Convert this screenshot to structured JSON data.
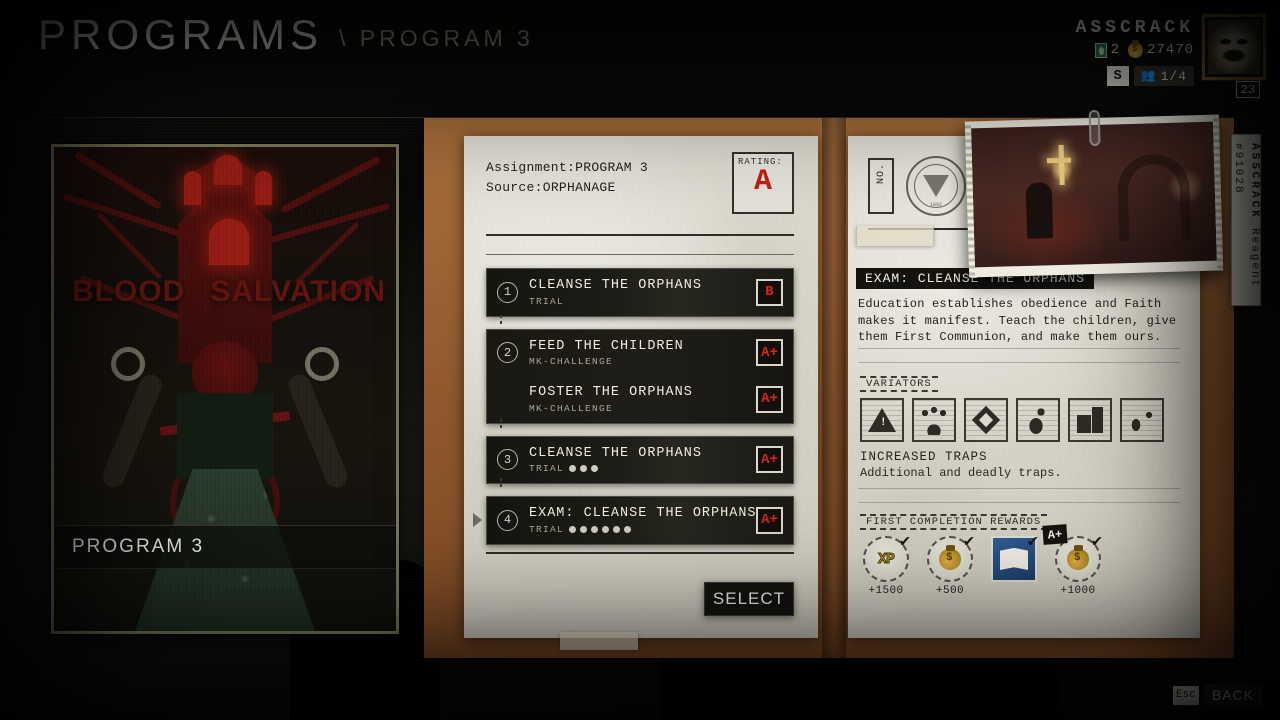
{
  "header": {
    "title": "PROGRAMS",
    "breadcrumb": "\\ PROGRAM 3"
  },
  "hud": {
    "player_name": "ASSCRACK",
    "bust_count": "2",
    "money": "27470",
    "rank": "S",
    "party": "1/4",
    "level": "23",
    "icons": {
      "bust": "bust-icon",
      "money_bag": "money-bag-icon",
      "party": "party-icon"
    }
  },
  "poster": {
    "word_left": "BLOOD",
    "word_right": "SALVATION",
    "label": "PROGRAM  3"
  },
  "dossier": {
    "assignment_label": "Assignment:",
    "assignment_value": "PROGRAM 3",
    "source_label": "Source:",
    "source_value": "ORPHANAGE",
    "rating_label": "RATING:",
    "rating_value": "A",
    "missions": [
      {
        "num": "1",
        "title": "CLEANSE THE ORPHANS",
        "sub": "TRIAL",
        "dots": 0,
        "grade": "B",
        "selected": false,
        "grouped": false
      },
      {
        "num": "2",
        "title": "FEED THE CHILDREN",
        "sub": "MK-CHALLENGE",
        "dots": 0,
        "grade": "A+",
        "selected": false,
        "grouped": true
      },
      {
        "num": "",
        "title": "FOSTER THE ORPHANS",
        "sub": "MK-CHALLENGE",
        "dots": 0,
        "grade": "A+",
        "selected": false,
        "grouped": true
      },
      {
        "num": "3",
        "title": "CLEANSE THE ORPHANS",
        "sub": "TRIAL",
        "dots": 3,
        "grade": "A+",
        "selected": false,
        "grouped": false
      },
      {
        "num": "4",
        "title": "EXAM: CLEANSE THE ORPHANS",
        "sub": "TRIAL",
        "dots": 6,
        "grade": "A+",
        "selected": true,
        "grouped": false
      }
    ],
    "select_button": "SELECT"
  },
  "detail": {
    "no_label": "NO.",
    "seal_year": "1892",
    "mission_title": "EXAM: CLEANSE THE ORPHANS",
    "description": "Education establishes obedience and Faith makes it manifest. Teach the children, give them First Communion, and make them ours.",
    "variators_header": "VARIATORS",
    "variators": [
      "hazard-triangle-icon",
      "crowd-icon",
      "diamond-icon",
      "figure-icon",
      "building-icon",
      "flask-icon"
    ],
    "variator_name": "INCREASED TRAPS",
    "variator_desc": "Additional and deadly traps.",
    "rewards_header": "FIRST COMPLETION REWARDS",
    "rewards": [
      {
        "icon": "xp-coin-icon",
        "amount": "+1500",
        "checked": true,
        "badge": ""
      },
      {
        "icon": "money-coin-icon",
        "amount": "+500",
        "checked": true,
        "badge": ""
      },
      {
        "icon": "item-book-icon",
        "amount": "",
        "checked": true,
        "badge": ""
      },
      {
        "icon": "money-coin-icon",
        "amount": "+1000",
        "checked": true,
        "badge": "A+"
      }
    ]
  },
  "side_tab": {
    "name": "ASSCRACK",
    "reagent": "Reagent #91028"
  },
  "footer": {
    "esc_key": "Esc",
    "back_label": "BACK"
  },
  "colors": {
    "accent_red": "#c01f18",
    "paper": "#d9d6ca",
    "binder": "#91592e",
    "gold": "#e8b84b"
  }
}
